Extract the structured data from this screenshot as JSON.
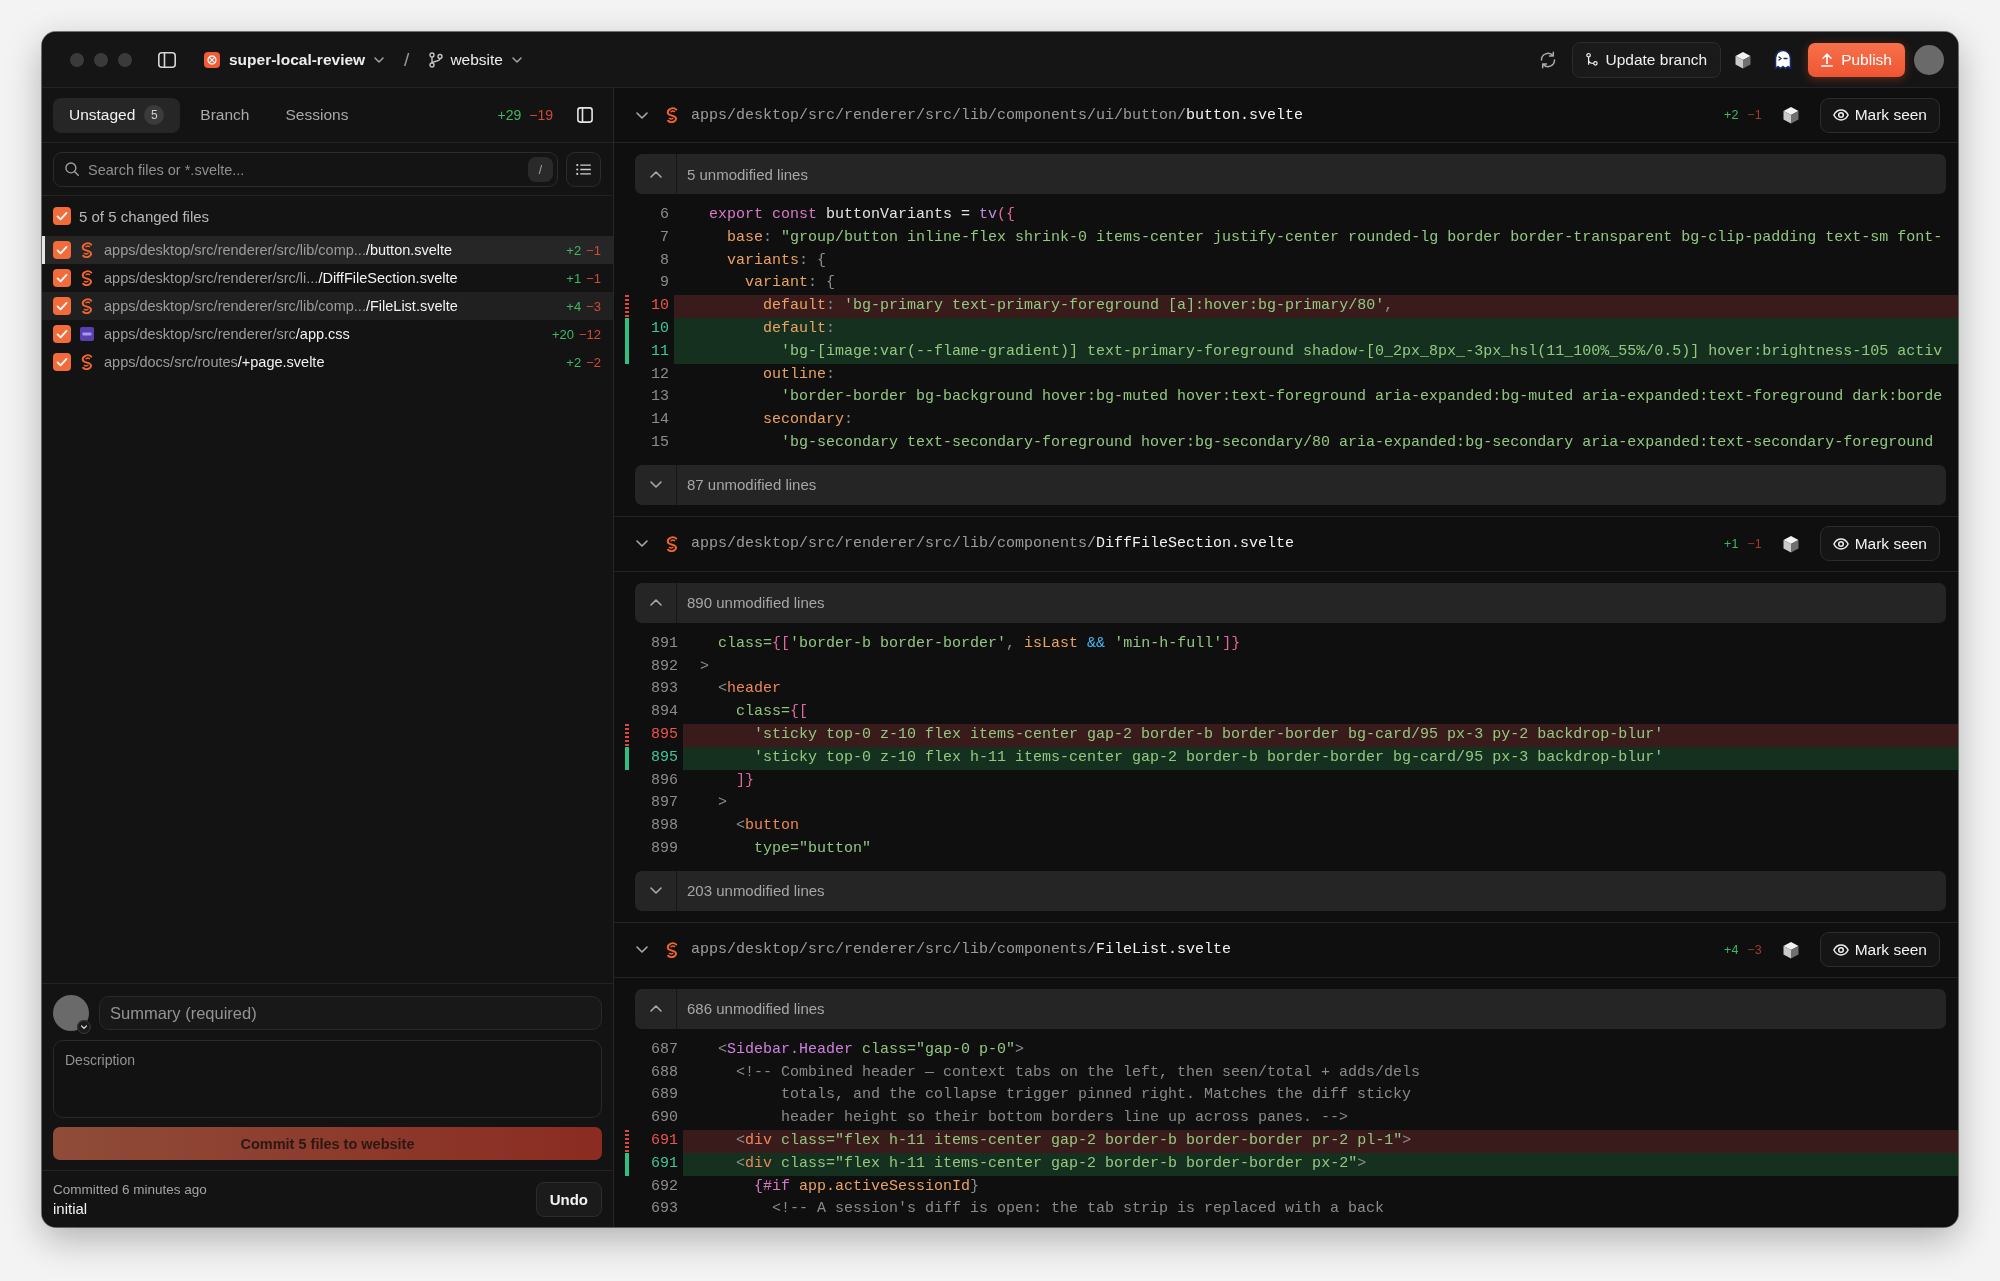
{
  "title_bar": {
    "repo": "super-local-review",
    "separator": "/",
    "branch": "website",
    "update_button": "Update branch",
    "publish_button": "Publish"
  },
  "sidebar": {
    "tabs": [
      {
        "label": "Unstaged",
        "count": "5",
        "selected": true
      },
      {
        "label": "Branch",
        "selected": false
      },
      {
        "label": "Sessions",
        "selected": false
      }
    ],
    "additions": "+29",
    "deletions": "−19",
    "search": {
      "placeholder": "Search files or *.svelte...",
      "shortcut": "/"
    },
    "select_all": {
      "label": "5 of 5 changed files",
      "checked": true
    },
    "files": [
      {
        "kind": "svelte",
        "dir": "apps/desktop/src/renderer/src/lib/comp...",
        "name": "/button.svelte",
        "additions": "+2",
        "deletions": "−1",
        "checked": true,
        "selected": true,
        "hovered": false
      },
      {
        "kind": "svelte",
        "dir": "apps/desktop/src/renderer/src/li...",
        "name": "/DiffFileSection.svelte",
        "additions": "+1",
        "deletions": "−1",
        "checked": true,
        "selected": false,
        "hovered": false
      },
      {
        "kind": "svelte",
        "dir": "apps/desktop/src/renderer/src/lib/comp...",
        "name": "/FileList.svelte",
        "additions": "+4",
        "deletions": "−3",
        "checked": true,
        "selected": false,
        "hovered": true
      },
      {
        "kind": "css",
        "dir": "apps/desktop/src/renderer/src",
        "name": "/app.css",
        "additions": "+20",
        "deletions": "−12",
        "checked": true,
        "selected": false,
        "hovered": false
      },
      {
        "kind": "svelte",
        "dir": "apps/docs/src/routes",
        "name": "/+page.svelte",
        "additions": "+2",
        "deletions": "−2",
        "checked": true,
        "selected": false,
        "hovered": false
      }
    ]
  },
  "commit": {
    "summary": {
      "placeholder": "Summary (required)"
    },
    "description": {
      "placeholder": "Description"
    },
    "button": {
      "label": "Commit 5 files to website",
      "disabled": true
    },
    "last_commit": {
      "time": "Committed 6 minutes ago",
      "message": "initial"
    },
    "undo_button": "Undo"
  },
  "diff": {
    "files": [
      {
        "kind": "svelte",
        "dir": "apps/desktop/src/renderer/src/lib/components/ui/button/",
        "name": "button.svelte",
        "additions": "+2",
        "deletions": "−1",
        "expanded": true,
        "mark_seen_button": "Mark seen",
        "rows": [
          {
            "kind": "fold_up",
            "label": "5 unmodified lines"
          },
          {
            "kind": "context",
            "number": "6",
            "tokens": [
              {
                "text": "  export",
                "kind": "keyword"
              },
              {
                "text": " const",
                "kind": "keyword"
              },
              {
                "text": " buttonVariants = ",
                "kind": "plain"
              },
              {
                "text": "tv",
                "kind": "function"
              },
              {
                "text": "({",
                "kind": "bracket"
              }
            ]
          },
          {
            "kind": "context",
            "number": "7",
            "tokens": [
              {
                "text": "    base",
                "kind": "property"
              },
              {
                "text": ": ",
                "kind": "punct"
              },
              {
                "text": "\"group/button inline-flex shrink-0 items-center justify-center rounded-lg border border-transparent bg-clip-padding text-sm font-",
                "kind": "string"
              }
            ]
          },
          {
            "kind": "context",
            "number": "8",
            "tokens": [
              {
                "text": "    variants",
                "kind": "property"
              },
              {
                "text": ": {",
                "kind": "punct"
              }
            ]
          },
          {
            "kind": "context",
            "number": "9",
            "tokens": [
              {
                "text": "      variant",
                "kind": "property"
              },
              {
                "text": ": {",
                "kind": "punct"
              }
            ]
          },
          {
            "kind": "removed",
            "number": "10",
            "tokens": [
              {
                "text": "        default",
                "kind": "property"
              },
              {
                "text": ": ",
                "kind": "punct"
              },
              {
                "text": "'bg-primary text-primary-foreground [a]:hover:bg-primary/80'",
                "kind": "string"
              },
              {
                "text": ",",
                "kind": "punct"
              }
            ]
          },
          {
            "kind": "added",
            "number": "10",
            "tokens": [
              {
                "text": "        default",
                "kind": "property"
              },
              {
                "text": ":",
                "kind": "punct"
              }
            ]
          },
          {
            "kind": "added",
            "number": "11",
            "tokens": [
              {
                "text": "          'bg-[image:var(--flame-gradient)] text-primary-foreground shadow-[0_2px_8px_-3px_hsl(11_100%_55%/0.5)] hover:brightness-105 activ",
                "kind": "string"
              }
            ]
          },
          {
            "kind": "context",
            "number": "12",
            "tokens": [
              {
                "text": "        outline",
                "kind": "property"
              },
              {
                "text": ":",
                "kind": "punct"
              }
            ]
          },
          {
            "kind": "context",
            "number": "13",
            "tokens": [
              {
                "text": "          'border-border bg-background hover:bg-muted hover:text-foreground aria-expanded:bg-muted aria-expanded:text-foreground dark:borde",
                "kind": "string"
              }
            ]
          },
          {
            "kind": "context",
            "number": "14",
            "tokens": [
              {
                "text": "        secondary",
                "kind": "property"
              },
              {
                "text": ":",
                "kind": "punct"
              }
            ]
          },
          {
            "kind": "context",
            "number": "15",
            "tokens": [
              {
                "text": "          'bg-secondary text-secondary-foreground hover:bg-secondary/80 aria-expanded:bg-secondary aria-expanded:text-secondary-foreground",
                "kind": "string"
              }
            ]
          },
          {
            "kind": "fold_down",
            "label": "87 unmodified lines"
          }
        ]
      },
      {
        "kind": "svelte",
        "dir": "apps/desktop/src/renderer/src/lib/components/",
        "name": "DiffFileSection.svelte",
        "additions": "+1",
        "deletions": "−1",
        "expanded": true,
        "mark_seen_button": "Mark seen",
        "rows": [
          {
            "kind": "fold_up",
            "label": "890 unmodified lines"
          },
          {
            "kind": "context",
            "number": "891",
            "tokens": [
              {
                "text": "  class=",
                "kind": "attr"
              },
              {
                "text": "{[",
                "kind": "bracket"
              },
              {
                "text": "'border-b border-border'",
                "kind": "string"
              },
              {
                "text": ", ",
                "kind": "punct"
              },
              {
                "text": "isLast",
                "kind": "variable"
              },
              {
                "text": " && ",
                "kind": "operator"
              },
              {
                "text": "'min-h-full'",
                "kind": "string"
              },
              {
                "text": "]}",
                "kind": "bracket"
              }
            ]
          },
          {
            "kind": "context",
            "number": "892",
            "tokens": [
              {
                "text": ">",
                "kind": "punct"
              }
            ]
          },
          {
            "kind": "context",
            "number": "893",
            "tokens": [
              {
                "text": "  <",
                "kind": "punct"
              },
              {
                "text": "header",
                "kind": "tag"
              }
            ]
          },
          {
            "kind": "context",
            "number": "894",
            "tokens": [
              {
                "text": "    class=",
                "kind": "attr"
              },
              {
                "text": "{[",
                "kind": "bracket"
              }
            ]
          },
          {
            "kind": "removed",
            "number": "895",
            "tokens": [
              {
                "text": "      'sticky top-0 z-10 flex items-center gap-2 border-b border-border bg-card/95 px-3 py-2 backdrop-blur'",
                "kind": "string"
              }
            ]
          },
          {
            "kind": "added",
            "number": "895",
            "tokens": [
              {
                "text": "      'sticky top-0 z-10 flex h-11 items-center gap-2 border-b border-border bg-card/95 px-3 backdrop-blur'",
                "kind": "string"
              }
            ]
          },
          {
            "kind": "context",
            "number": "896",
            "tokens": [
              {
                "text": "    ]}",
                "kind": "bracket"
              }
            ]
          },
          {
            "kind": "context",
            "number": "897",
            "tokens": [
              {
                "text": "  >",
                "kind": "punct"
              }
            ]
          },
          {
            "kind": "context",
            "number": "898",
            "tokens": [
              {
                "text": "    <",
                "kind": "punct"
              },
              {
                "text": "button",
                "kind": "tag"
              }
            ]
          },
          {
            "kind": "context",
            "number": "899",
            "tokens": [
              {
                "text": "      type=",
                "kind": "attr"
              },
              {
                "text": "\"button\"",
                "kind": "string"
              }
            ]
          },
          {
            "kind": "fold_down",
            "label": "203 unmodified lines"
          }
        ]
      },
      {
        "kind": "svelte",
        "dir": "apps/desktop/src/renderer/src/lib/components/",
        "name": "FileList.svelte",
        "additions": "+4",
        "deletions": "−3",
        "expanded": true,
        "mark_seen_button": "Mark seen",
        "rows": [
          {
            "kind": "fold_up",
            "label": "686 unmodified lines"
          },
          {
            "kind": "context",
            "number": "687",
            "tokens": [
              {
                "text": "  <",
                "kind": "punct"
              },
              {
                "text": "Sidebar.Header",
                "kind": "component"
              },
              {
                "text": " class=",
                "kind": "attr"
              },
              {
                "text": "\"gap-0 p-0\"",
                "kind": "string"
              },
              {
                "text": ">",
                "kind": "punct"
              }
            ]
          },
          {
            "kind": "context",
            "number": "688",
            "tokens": [
              {
                "text": "    <!-- Combined header — context tabs on the left, then seen/total + adds/dels",
                "kind": "comment"
              }
            ]
          },
          {
            "kind": "context",
            "number": "689",
            "tokens": [
              {
                "text": "         totals, and the collapse trigger pinned right. Matches the diff sticky",
                "kind": "comment"
              }
            ]
          },
          {
            "kind": "context",
            "number": "690",
            "tokens": [
              {
                "text": "         header height so their bottom borders line up across panes. -->",
                "kind": "comment"
              }
            ]
          },
          {
            "kind": "removed",
            "number": "691",
            "tokens": [
              {
                "text": "    <",
                "kind": "punct"
              },
              {
                "text": "div",
                "kind": "tag"
              },
              {
                "text": " class=",
                "kind": "attr"
              },
              {
                "text": "\"flex h-11 items-center gap-2 border-b border-border pr-2 pl-1\"",
                "kind": "string"
              },
              {
                "text": ">",
                "kind": "punct"
              }
            ]
          },
          {
            "kind": "added",
            "number": "691",
            "tokens": [
              {
                "text": "    <",
                "kind": "punct"
              },
              {
                "text": "div",
                "kind": "tag"
              },
              {
                "text": " class=",
                "kind": "attr"
              },
              {
                "text": "\"flex h-11 items-center gap-2 border-b border-border px-2\"",
                "kind": "string"
              },
              {
                "text": ">",
                "kind": "punct"
              }
            ]
          },
          {
            "kind": "context",
            "number": "692",
            "tokens": [
              {
                "text": "      {#if",
                "kind": "keyword"
              },
              {
                "text": " app.activeSessionId",
                "kind": "variable"
              },
              {
                "text": "}",
                "kind": "punct"
              }
            ]
          },
          {
            "kind": "context",
            "number": "693",
            "tokens": [
              {
                "text": "        <!-- A session's diff is open: the tab strip is replaced with a back",
                "kind": "comment"
              }
            ]
          }
        ]
      }
    ]
  }
}
